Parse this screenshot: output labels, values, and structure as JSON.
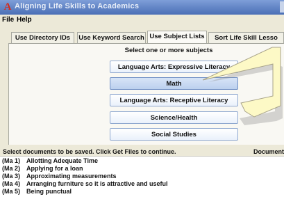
{
  "window": {
    "title": "Aligning Life Skills to Academics",
    "icon_glyph": "A"
  },
  "menu": {
    "items": [
      "File",
      "Help"
    ]
  },
  "tabs": [
    {
      "label": "Use Directory IDs",
      "active": false
    },
    {
      "label": "Use Keyword Search",
      "active": false
    },
    {
      "label": "Use Subject Lists",
      "active": true
    },
    {
      "label": "Sort Life Skill Lesso",
      "active": false
    }
  ],
  "subjects": {
    "prompt": "Select one or more subjects",
    "buttons": [
      {
        "label": "Language Arts: Expressive Literacy",
        "selected": false
      },
      {
        "label": "Math",
        "selected": true
      },
      {
        "label": "Language Arts: Receptive Literacy",
        "selected": false
      },
      {
        "label": "Science/Health",
        "selected": false
      },
      {
        "label": "Social Studies",
        "selected": false
      }
    ]
  },
  "status": {
    "instruction": "Select documents to be saved. Click Get Files to continue.",
    "documents_label": "Documents"
  },
  "documents": [
    {
      "code": "(Ma 1)",
      "title": "Allotting Adequate Time"
    },
    {
      "code": "(Ma 2)",
      "title": "Applying for a loan"
    },
    {
      "code": "(Ma 3)",
      "title": "Approximating measurements"
    },
    {
      "code": "(Ma 4)",
      "title": "Arranging furniture so it is attractive and useful"
    },
    {
      "code": "(Ma 5)",
      "title": "Being punctual"
    }
  ],
  "colors": {
    "titlebar": "#4a6fb6",
    "selected_button": "#bcd0ee",
    "callout_fill": "#fdf9c6"
  }
}
